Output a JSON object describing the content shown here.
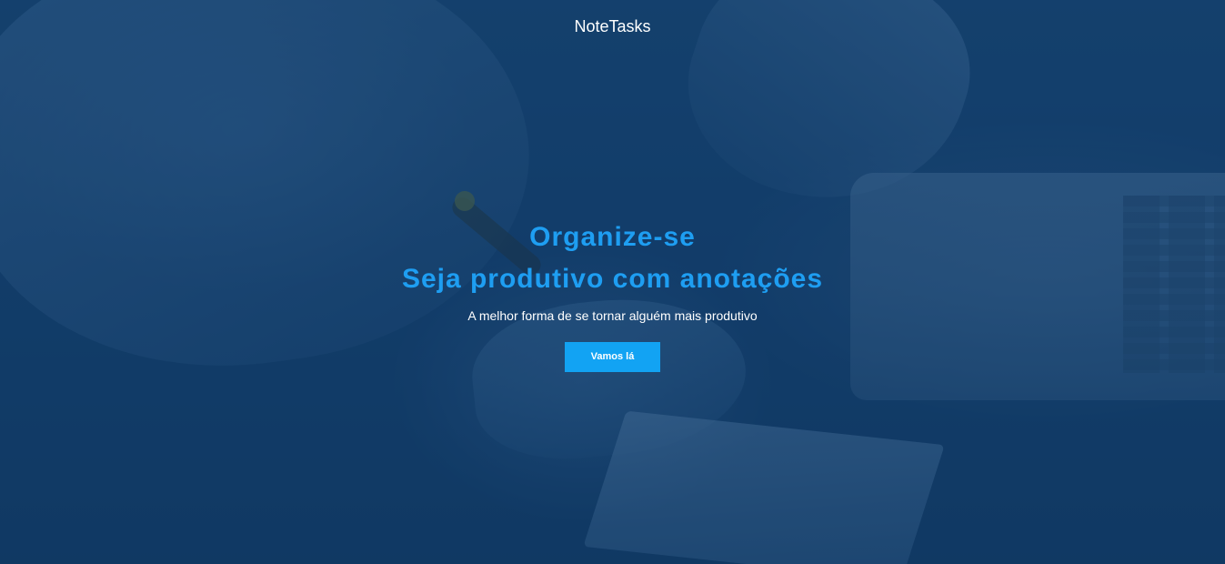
{
  "header": {
    "brand": "NoteTasks"
  },
  "hero": {
    "title_line1": "Organize-se",
    "title_line2": "Seja produtivo com anotações",
    "subtitle": "A melhor forma de se tornar alguém mais produtivo",
    "cta_label": "Vamos lá"
  },
  "colors": {
    "overlay": "#0e3864",
    "headline": "#1e9ef2",
    "cta_background": "#12a3f3",
    "text": "#ffffff"
  }
}
